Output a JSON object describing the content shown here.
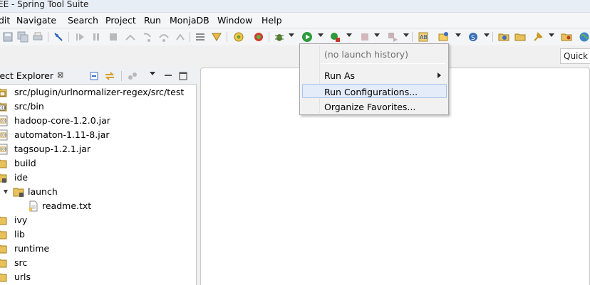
{
  "window": {
    "title": "EE - Spring Tool Suite"
  },
  "menubar": {
    "items": [
      "dit",
      "Navigate",
      "Search",
      "Project",
      "Run",
      "MonjaDB",
      "Window",
      "Help"
    ]
  },
  "quick_access": {
    "label": "Quick A"
  },
  "explorer": {
    "title": "ject Explorer",
    "close_glyph": "⊠",
    "items": [
      {
        "label": "src/plugin/urlnormalizer-regex/src/test",
        "icon": "source-folder-icon"
      },
      {
        "label": "src/bin",
        "icon": "binary-folder-icon"
      },
      {
        "label": "hadoop-core-1.2.0.jar",
        "icon": "jar-icon"
      },
      {
        "label": "automaton-1.11-8.jar",
        "icon": "jar-icon"
      },
      {
        "label": "tagsoup-1.2.1.jar",
        "icon": "jar-icon"
      },
      {
        "label": "build",
        "icon": "folder-icon"
      },
      {
        "label": "ide",
        "icon": "folder-icon"
      },
      {
        "label": "launch",
        "icon": "folder-icon"
      },
      {
        "label": "readme.txt",
        "icon": "text-file-icon"
      },
      {
        "label": "ivy",
        "icon": "folder-icon"
      },
      {
        "label": "lib",
        "icon": "folder-icon"
      },
      {
        "label": "runtime",
        "icon": "folder-icon"
      },
      {
        "label": "src",
        "icon": "folder-icon"
      },
      {
        "label": "urls",
        "icon": "folder-icon"
      }
    ]
  },
  "run_menu": {
    "history": "(no launch history)",
    "run_as": "Run As",
    "run_configurations": "Run Configurations...",
    "organize_favorites": "Organize Favorites..."
  },
  "colors": {
    "selection": "#e3ecf8",
    "selection_border": "#a9c4ea",
    "folder": "#e8c15a",
    "run_green": "#2e9a3a"
  }
}
